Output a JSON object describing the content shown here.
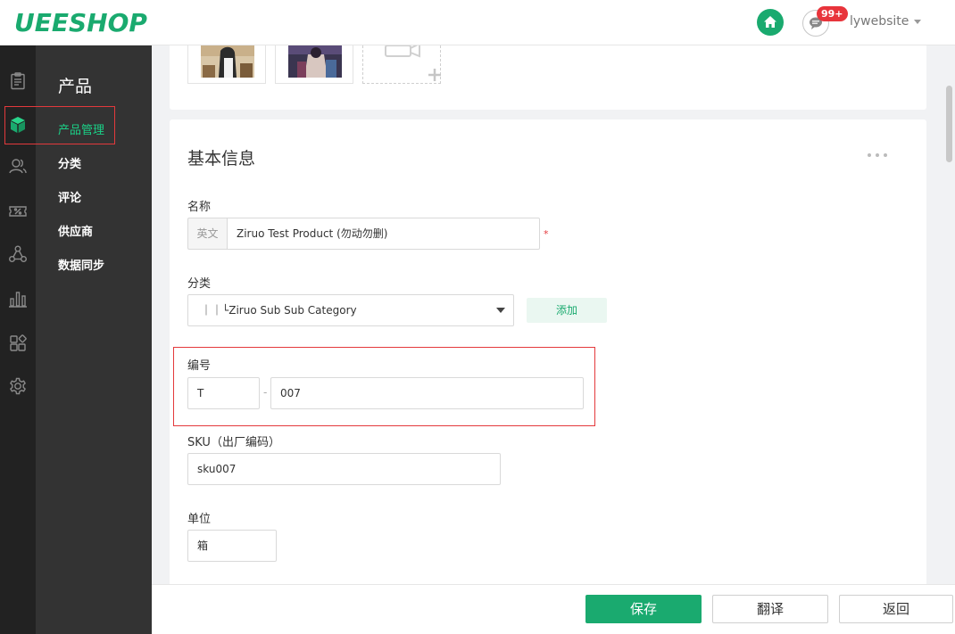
{
  "header": {
    "logo": "UEESHOP",
    "badge": "99+",
    "username": "lywebsite"
  },
  "icons": {
    "home": "home-icon",
    "message": "message-icon",
    "rail": [
      "order-icon",
      "product-icon",
      "customer-icon",
      "promotion-icon",
      "distribution-icon",
      "stats-icon",
      "apps-icon",
      "settings-icon"
    ]
  },
  "subnav": {
    "title": "产品",
    "items": [
      {
        "label": "产品管理",
        "active": true
      },
      {
        "label": "分类"
      },
      {
        "label": "评论"
      },
      {
        "label": "供应商"
      },
      {
        "label": "数据同步"
      }
    ]
  },
  "form": {
    "section_title": "基本信息",
    "name": {
      "label": "名称",
      "lang": "英文",
      "value": "Ziruo Test Product (勿动勿删)",
      "required_mark": "*"
    },
    "category": {
      "label": "分类",
      "value": "｜｜└Ziruo Sub Sub Category",
      "add_label": "添加"
    },
    "number": {
      "label": "编号",
      "prefix": "T",
      "separator": "-",
      "value": "007"
    },
    "sku": {
      "label": "SKU（出厂编码）",
      "value": "sku007"
    },
    "unit": {
      "label": "单位",
      "value": "箱"
    }
  },
  "actions": {
    "save": "保存",
    "translate": "翻译",
    "back": "返回"
  },
  "colors": {
    "brand": "#1aaa6f",
    "highlight": "#e4393c"
  }
}
